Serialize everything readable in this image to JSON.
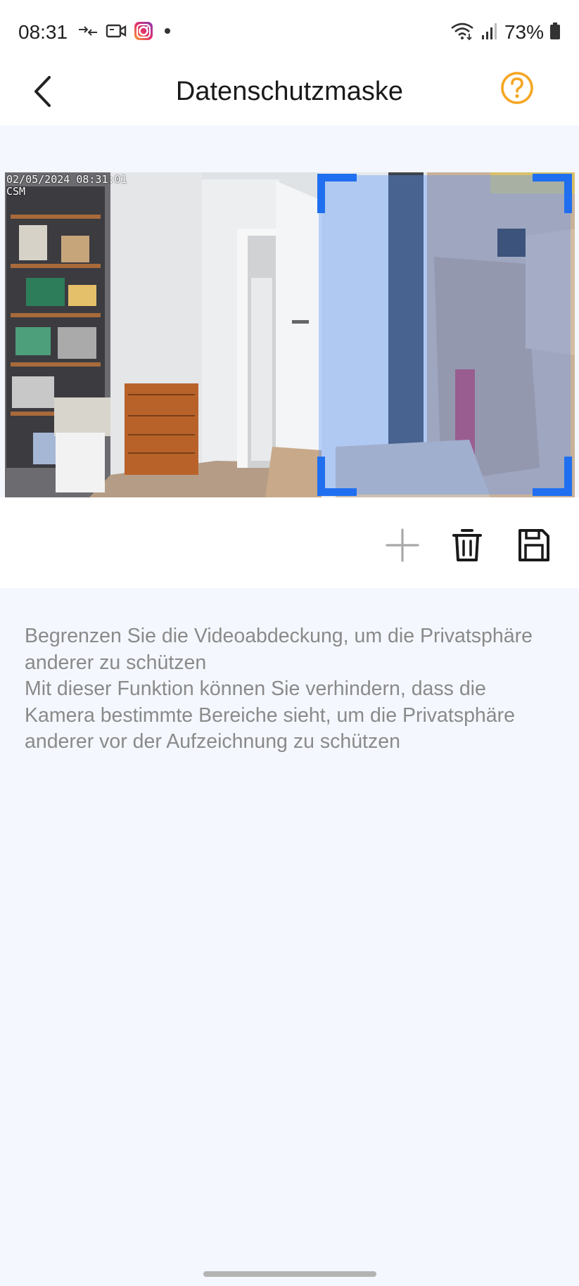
{
  "status_bar": {
    "time": "08:31",
    "battery": "73%",
    "left_icons": [
      "transfer-icon",
      "video-camera-icon",
      "instagram-icon",
      "dot-icon"
    ],
    "right_icons": [
      "wifi-icon",
      "signal-icon",
      "battery-icon"
    ]
  },
  "header": {
    "title": "Datenschutzmaske",
    "back_icon": "chevron-left-icon",
    "help_icon": "help-circle-icon",
    "help_color": "#f5a623"
  },
  "camera": {
    "osd_timestamp": "02/05/2024 08:31:01\nCSM",
    "mask_color": "#1f6ff0"
  },
  "toolbar": {
    "add_icon": "plus-icon",
    "delete_icon": "trash-icon",
    "save_icon": "save-icon"
  },
  "description": {
    "line1": "Begrenzen Sie die Videoabdeckung, um die Privatsphäre anderer zu schützen",
    "line2": "Mit dieser Funktion können Sie verhindern, dass die Kamera bestimmte Bereiche sieht, um die Privatsphäre anderer vor der Aufzeichnung zu schützen"
  }
}
